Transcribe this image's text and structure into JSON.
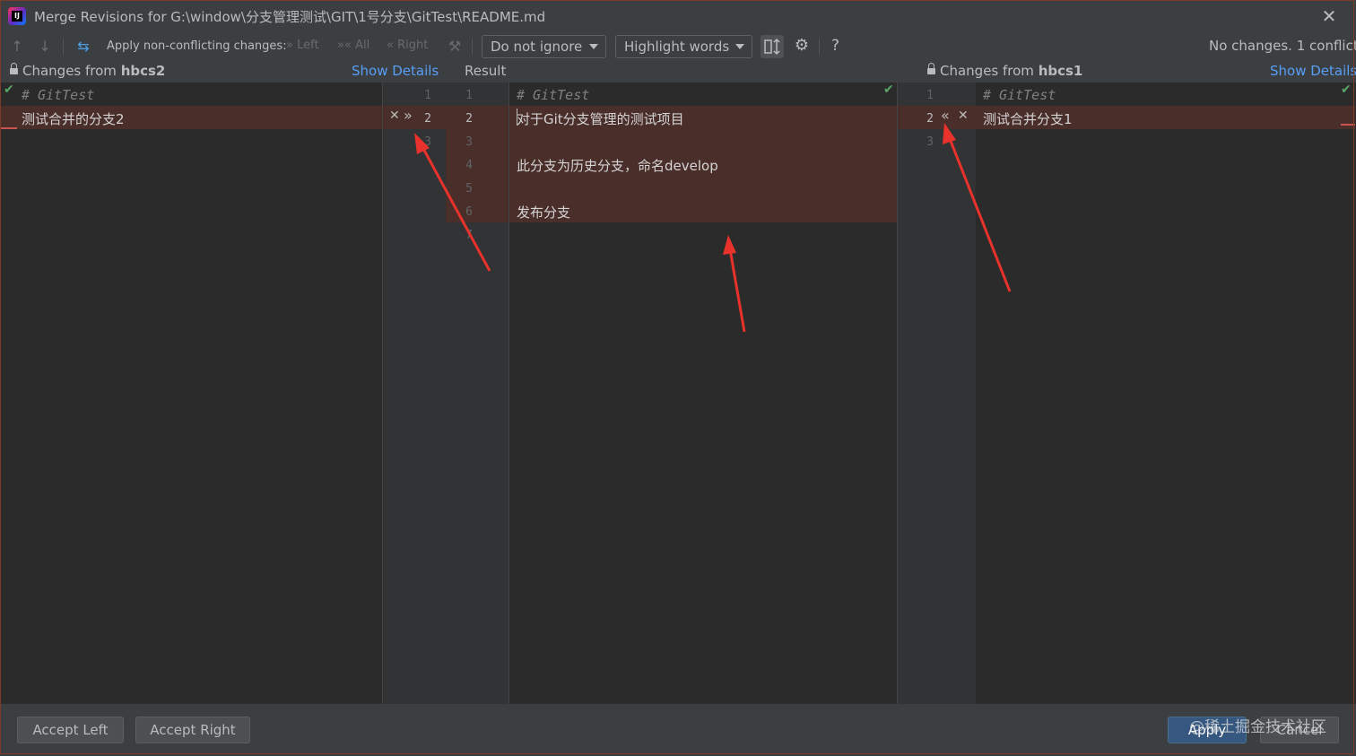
{
  "window": {
    "title": "Merge Revisions for G:\\window\\分支管理测试\\GIT\\1号分支\\GitTest\\README.md",
    "logo_text": "IJ"
  },
  "toolbar": {
    "apply_label": "Apply non-conflicting changes:",
    "left_label": "Left",
    "all_label": "All",
    "right_label": "Right",
    "whitespace_select": "Do not ignore",
    "highlight_select": "Highlight words",
    "status": "No changes. 1 conflict",
    "help_label": "?"
  },
  "header": {
    "left_prefix": "Changes from ",
    "left_branch": "hbcs2",
    "left_link": "Show Details",
    "middle_title": "Result",
    "right_prefix": "Changes from ",
    "right_branch": "hbcs1",
    "right_link": "Show Details"
  },
  "left_editor": {
    "lines": [
      "# GitTest",
      "测试合并的分支2"
    ]
  },
  "left_gutter": {
    "numbers_left": [
      "1",
      "2",
      "3"
    ],
    "numbers_right": [
      "1",
      "2",
      "3",
      "4",
      "5",
      "6",
      "7"
    ]
  },
  "result_editor": {
    "lines": [
      "# GitTest",
      "对于Git分支管理的测试项目",
      "",
      "此分支为历史分支，命名develop",
      "",
      "发布分支"
    ]
  },
  "right_gutter": {
    "numbers": [
      "1",
      "2",
      "3"
    ]
  },
  "right_editor": {
    "lines": [
      "# GitTest",
      "测试合并分支1"
    ]
  },
  "buttons": {
    "accept_left": "Accept Left",
    "accept_right": "Accept Right",
    "apply": "Apply",
    "cancel": "Cancel"
  },
  "watermark": "@稀土掘金技术社区",
  "colors": {
    "accent_link": "#589df6",
    "conflict": "#4a2e2a",
    "annotation_arrow": "#e8322b"
  }
}
